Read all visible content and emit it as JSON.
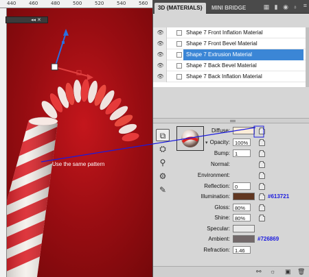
{
  "ruler": {
    "numbers": [
      "440",
      "460",
      "480",
      "500",
      "520",
      "540",
      "560"
    ]
  },
  "canvas": {
    "mini_toolbar_text": "◂◂ ✕",
    "callout": "Use the same pattern"
  },
  "panel": {
    "tabs": [
      {
        "label": "3D {MATERIALS}",
        "active": true
      },
      {
        "label": "MINI BRIDGE",
        "active": false
      }
    ],
    "menu_icon": "panel-menu-icon",
    "materials": [
      {
        "label": "Shape 7 Front Inflation Material",
        "selected": false
      },
      {
        "label": "Shape 7 Front Bevel Material",
        "selected": false
      },
      {
        "label": "Shape 7 Extrusion Material",
        "selected": true
      },
      {
        "label": "Shape 7 Back Bevel Material",
        "selected": false
      },
      {
        "label": "Shape 7 Back Inflation Material",
        "selected": false
      }
    ]
  },
  "properties": {
    "diffuse": {
      "label": "Diffuse:",
      "color": "#fbecd8"
    },
    "opacity": {
      "label": "Opacity:",
      "value": "100%"
    },
    "bump": {
      "label": "Bump:",
      "value": "1"
    },
    "normal": {
      "label": "Normal:"
    },
    "environment": {
      "label": "Environment:"
    },
    "reflection": {
      "label": "Reflection:",
      "value": "0"
    },
    "illumination": {
      "label": "Illumination:",
      "color": "#613721",
      "note": "#613721"
    },
    "gloss": {
      "label": "Gloss:",
      "value": "80%"
    },
    "shine": {
      "label": "Shine:",
      "value": "80%"
    },
    "specular": {
      "label": "Specular:",
      "color": "#e9e9e9"
    },
    "ambient": {
      "label": "Ambient:",
      "color": "#726869",
      "note": "#726869"
    },
    "refraction": {
      "label": "Refraction:",
      "value": "1.46"
    }
  },
  "colors": {
    "selection": "#3b86d6",
    "note_blue": "#1a1adf",
    "canvas_red": "#c4161c"
  }
}
